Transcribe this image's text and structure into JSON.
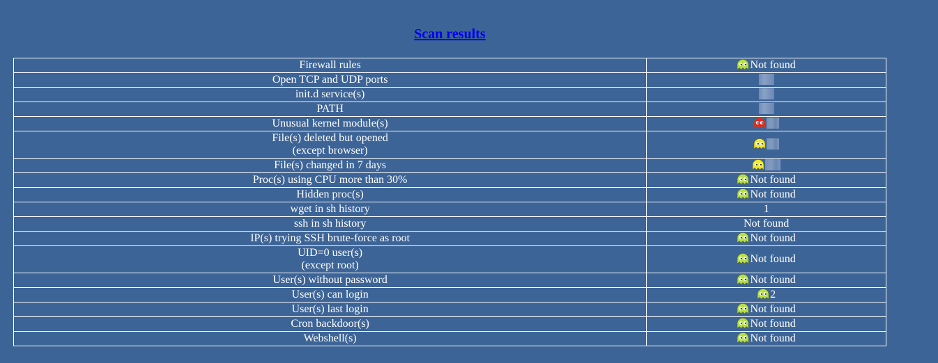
{
  "page": {
    "title": "Scan results",
    "link_color": "#0000ee",
    "background_color": "#3d6496"
  },
  "icons": {
    "ok": {
      "name": "green-ghost-icon",
      "color": "#b4e04a"
    },
    "warn": {
      "name": "yellow-ghost-icon",
      "color": "#f2e82a"
    },
    "alert": {
      "name": "red-ghost-icon",
      "color": "#e42626"
    }
  },
  "rows": [
    {
      "label": [
        "Firewall rules"
      ],
      "icon": "ok",
      "value": "Not found",
      "redacted": false
    },
    {
      "label": [
        "Open TCP and UDP ports"
      ],
      "icon": "",
      "value": "",
      "redacted": true
    },
    {
      "label": [
        "init.d service(s)"
      ],
      "icon": "",
      "value": "",
      "redacted": true
    },
    {
      "label": [
        "PATH"
      ],
      "icon": "",
      "value": "",
      "redacted": true
    },
    {
      "label": [
        "Unusual kernel module(s)"
      ],
      "icon": "alert",
      "value": "",
      "redacted": true
    },
    {
      "label": [
        "File(s) deleted but opened",
        "(except browser)"
      ],
      "icon": "warn",
      "value": "",
      "redacted": true
    },
    {
      "label": [
        "File(s) changed in 7 days"
      ],
      "icon": "warn",
      "value": "",
      "redacted": true
    },
    {
      "label": [
        "Proc(s) using CPU more than 30%"
      ],
      "icon": "ok",
      "value": "Not found",
      "redacted": false
    },
    {
      "label": [
        "Hidden proc(s)"
      ],
      "icon": "ok",
      "value": "Not found",
      "redacted": false
    },
    {
      "label": [
        "wget in sh history"
      ],
      "icon": "",
      "value": "1",
      "redacted": false
    },
    {
      "label": [
        "ssh in sh history"
      ],
      "icon": "",
      "value": "Not found",
      "redacted": false
    },
    {
      "label": [
        "IP(s) trying SSH brute-force as root"
      ],
      "icon": "ok",
      "value": "Not found",
      "redacted": false
    },
    {
      "label": [
        "UID=0 user(s)",
        "(except root)"
      ],
      "icon": "ok",
      "value": "Not found",
      "redacted": false
    },
    {
      "label": [
        "User(s) without password"
      ],
      "icon": "ok",
      "value": "Not found",
      "redacted": false
    },
    {
      "label": [
        "User(s) can login"
      ],
      "icon": "ok",
      "value": "2",
      "redacted": false
    },
    {
      "label": [
        "User(s) last login"
      ],
      "icon": "ok",
      "value": "Not found",
      "redacted": false
    },
    {
      "label": [
        "Cron backdoor(s)"
      ],
      "icon": "ok",
      "value": "Not found",
      "redacted": false
    },
    {
      "label": [
        "Webshell(s)"
      ],
      "icon": "ok",
      "value": "Not found",
      "redacted": false
    }
  ]
}
